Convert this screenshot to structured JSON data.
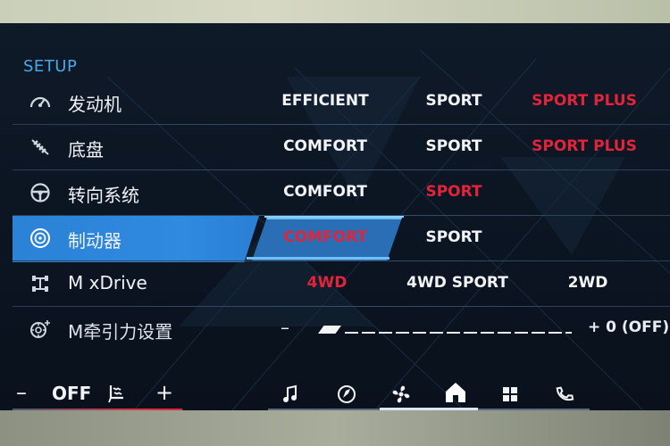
{
  "title": "SETUP",
  "rows": [
    {
      "label": "发动机",
      "icon": "gauge-icon",
      "options": [
        "EFFICIENT",
        "SPORT",
        "SPORT PLUS"
      ]
    },
    {
      "label": "底盘",
      "icon": "suspension-icon",
      "options": [
        "COMFORT",
        "SPORT",
        "SPORT PLUS"
      ]
    },
    {
      "label": "转向系统",
      "icon": "steering-wheel-icon",
      "options": [
        "COMFORT",
        "SPORT"
      ]
    },
    {
      "label": "制动器",
      "icon": "brake-disc-icon",
      "options": [
        "COMFORT",
        "SPORT"
      ]
    },
    {
      "label": "M xDrive",
      "icon": "drivetrain-icon",
      "options": [
        "4WD",
        "4WD SPORT",
        "2WD"
      ]
    },
    {
      "label": "M牵引力设置",
      "icon": "traction-icon",
      "slider_min": "–",
      "slider_value": "+ 0 (OFF)",
      "slider_level": 0
    }
  ],
  "bottom": {
    "minus": "–",
    "ac_state": "OFF",
    "plus": "+"
  },
  "colors": {
    "accent_blue": "#2f8ae0",
    "title_blue": "#4aa8ea",
    "active_red": "#e2233a",
    "text": "#f2f4f6"
  }
}
